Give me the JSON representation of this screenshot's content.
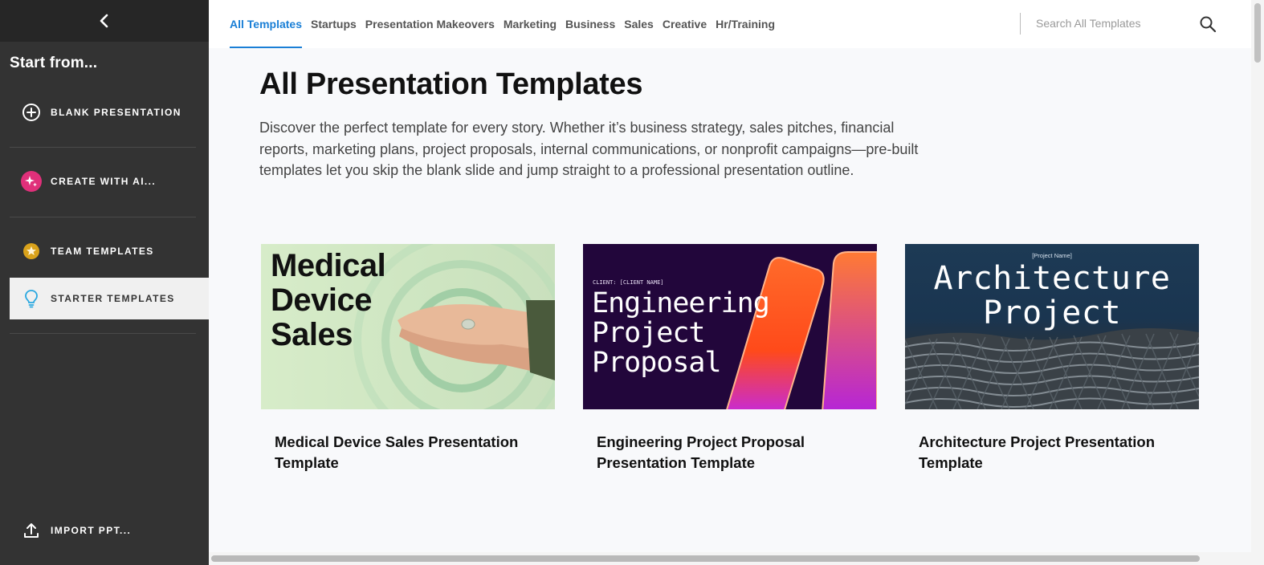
{
  "sidebar": {
    "back_icon": "chevron-left-icon",
    "start_from": "Start from...",
    "items": [
      {
        "label": "BLANK PRESENTATION",
        "icon": "plus-circle-icon"
      },
      {
        "label": "CREATE WITH AI...",
        "icon": "sparkle-icon"
      },
      {
        "label": "TEAM TEMPLATES",
        "icon": "star-badge-icon"
      },
      {
        "label": "STARTER TEMPLATES",
        "icon": "lightbulb-icon"
      },
      {
        "label": "IMPORT PPT...",
        "icon": "upload-icon"
      }
    ],
    "active_item": "STARTER TEMPLATES"
  },
  "nav": {
    "tabs": [
      {
        "label": "All Templates"
      },
      {
        "label": "Startups"
      },
      {
        "label": "Presentation Makeovers"
      },
      {
        "label": "Marketing"
      },
      {
        "label": "Business"
      },
      {
        "label": "Sales"
      },
      {
        "label": "Creative"
      },
      {
        "label": "Hr/Training"
      }
    ],
    "active_tab": "All Templates",
    "search": {
      "placeholder": "Search All Templates",
      "value": "",
      "icon": "search-icon"
    }
  },
  "main": {
    "title": "All Presentation Templates",
    "description": "Discover the perfect template for every story. Whether it’s business strategy, sales pitches, financial reports, marketing plans, project proposals, internal communications, or nonprofit campaigns—pre-built templates let you skip the blank slide and jump straight to a professional presentation outline.",
    "cards": [
      {
        "title": "Medical Device Sales Presentation Template",
        "thumb_text": "Medical Device Sales"
      },
      {
        "title": "Engineering Project Proposal Presentation Template",
        "thumb_client": "CLIENT: [CLIENT NAME]",
        "thumb_text": "Engineering Project Proposal"
      },
      {
        "title": "Architecture Project Presentation Template",
        "thumb_project": "[Project Name]",
        "thumb_text": "Architecture Project"
      }
    ]
  },
  "colors": {
    "sidebar_bg": "#333333",
    "accent": "#1a7fd6",
    "ai_pink": "#e0307a",
    "team_gold": "#d9a21b",
    "bulb_cyan": "#2aa8e0"
  }
}
